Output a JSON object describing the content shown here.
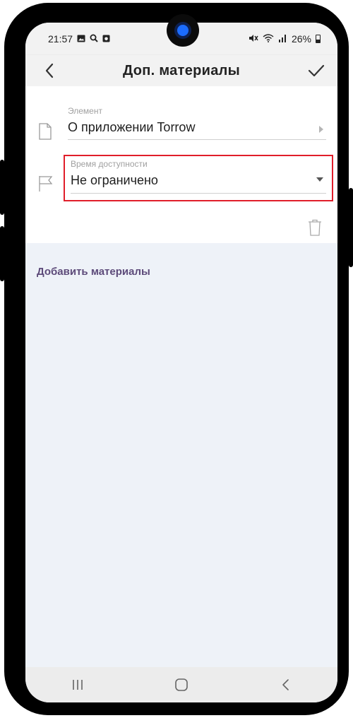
{
  "status_bar": {
    "time": "21:57",
    "battery_text": "26%",
    "left_icons": [
      "image-icon",
      "search-icon",
      "camera-app-icon"
    ],
    "right_icons": [
      "mute-icon",
      "wifi-icon",
      "signal-icon",
      "battery-icon"
    ]
  },
  "app_bar": {
    "title": "Доп. материалы",
    "back_icon": "chevron-left-icon",
    "confirm_icon": "check-icon"
  },
  "form": {
    "element": {
      "label": "Элемент",
      "value": "О приложении Torrow",
      "icon": "document-icon"
    },
    "availability": {
      "label": "Время доступности",
      "value": "Не ограничено",
      "icon": "flag-icon",
      "highlight_color": "#e01e2a"
    },
    "delete_icon": "trash-icon"
  },
  "add_materials_label": "Добавить материалы",
  "nav_bar": {
    "icons": [
      "recent-apps-icon",
      "home-icon",
      "back-icon"
    ]
  },
  "colors": {
    "accent": "#5d4b7a",
    "background": "#eef2f8",
    "highlight": "#e01e2a"
  }
}
